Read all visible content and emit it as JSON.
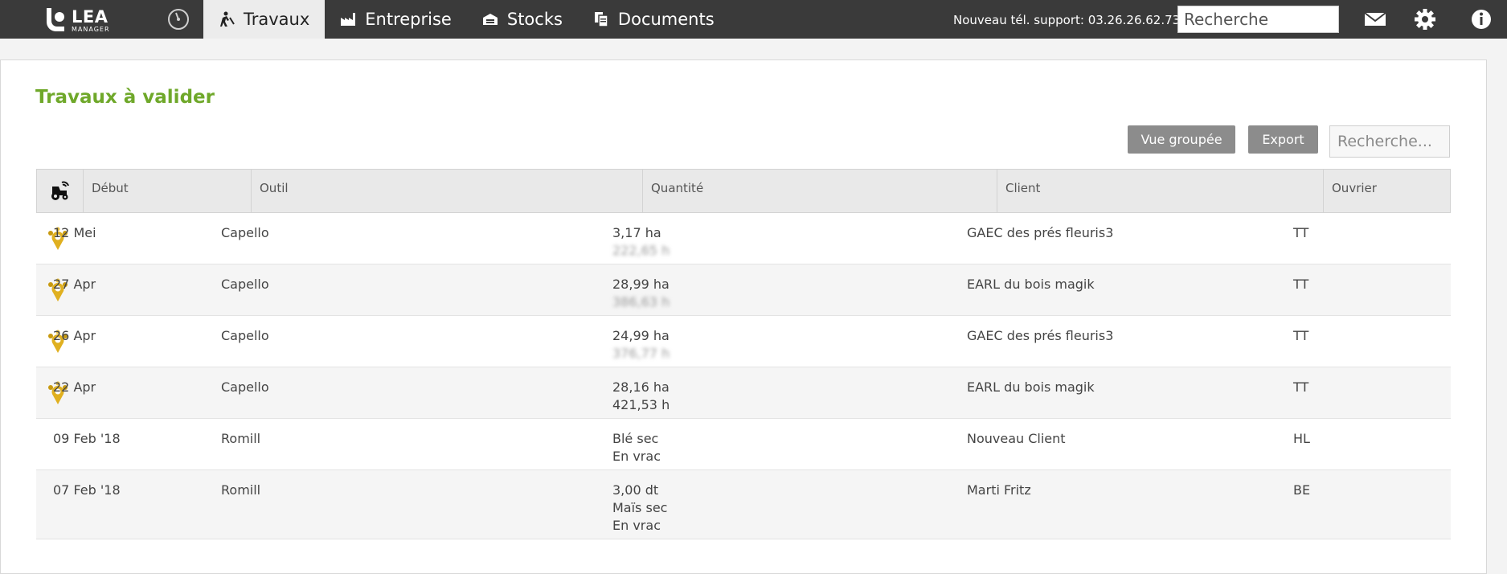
{
  "header": {
    "logo_text": "LEA",
    "logo_subtext": "MANAGER",
    "nav": [
      {
        "label": "Travaux",
        "icon": "worker-icon",
        "active": true
      },
      {
        "label": "Entreprise",
        "icon": "factory-icon",
        "active": false
      },
      {
        "label": "Stocks",
        "icon": "warehouse-icon",
        "active": false
      },
      {
        "label": "Documents",
        "icon": "documents-icon",
        "active": false
      }
    ],
    "support_text": "Nouveau tél. support: 03.26.26.62.73",
    "search_placeholder": "Recherche"
  },
  "main": {
    "title": "Travaux à valider",
    "buttons": {
      "grouped_view": "Vue groupée",
      "export": "Export"
    },
    "search_placeholder": "Recherche...",
    "table": {
      "columns": [
        "Début",
        "Outil",
        "Quantité",
        "Client",
        "Ouvrier"
      ],
      "rows": [
        {
          "debut": "12 Mei",
          "outil": "Capello",
          "quantite": [
            "3,17 ha",
            "222,65 h"
          ],
          "client": "GAEC des prés fleuris3",
          "ouvrier": "TT",
          "has_icon": true,
          "blurred_line": 1
        },
        {
          "debut": "27 Apr",
          "outil": "Capello",
          "quantite": [
            "28,99 ha",
            "386,63 h"
          ],
          "client": "EARL du bois magik",
          "ouvrier": "TT",
          "has_icon": true,
          "blurred_line": 1
        },
        {
          "debut": "26 Apr",
          "outil": "Capello",
          "quantite": [
            "24,99 ha",
            "376,77 h"
          ],
          "client": "GAEC des prés fleuris3",
          "ouvrier": "TT",
          "has_icon": true,
          "blurred_line": 1
        },
        {
          "debut": "22 Apr",
          "outil": "Capello",
          "quantite": [
            "28,16 ha",
            "421,53 h"
          ],
          "client": "EARL du bois magik",
          "ouvrier": "TT",
          "has_icon": true,
          "blurred_line": -1
        },
        {
          "debut": "09 Feb '18",
          "outil": "Romill",
          "quantite": [
            "Blé sec",
            "En vrac"
          ],
          "client": "Nouveau Client",
          "ouvrier": "HL",
          "has_icon": false,
          "blurred_line": -1
        },
        {
          "debut": "07 Feb '18",
          "outil": "Romill",
          "quantite": [
            "3,00 dt",
            "Maïs sec",
            "En vrac"
          ],
          "client": "Marti Fritz",
          "ouvrier": "BE",
          "has_icon": false,
          "blurred_line": -1
        }
      ]
    }
  },
  "colors": {
    "topbar": "#3a3a3a",
    "title_green": "#6fa82a",
    "button_gray": "#8c8c8c",
    "marker_gold": "#e0b020"
  }
}
